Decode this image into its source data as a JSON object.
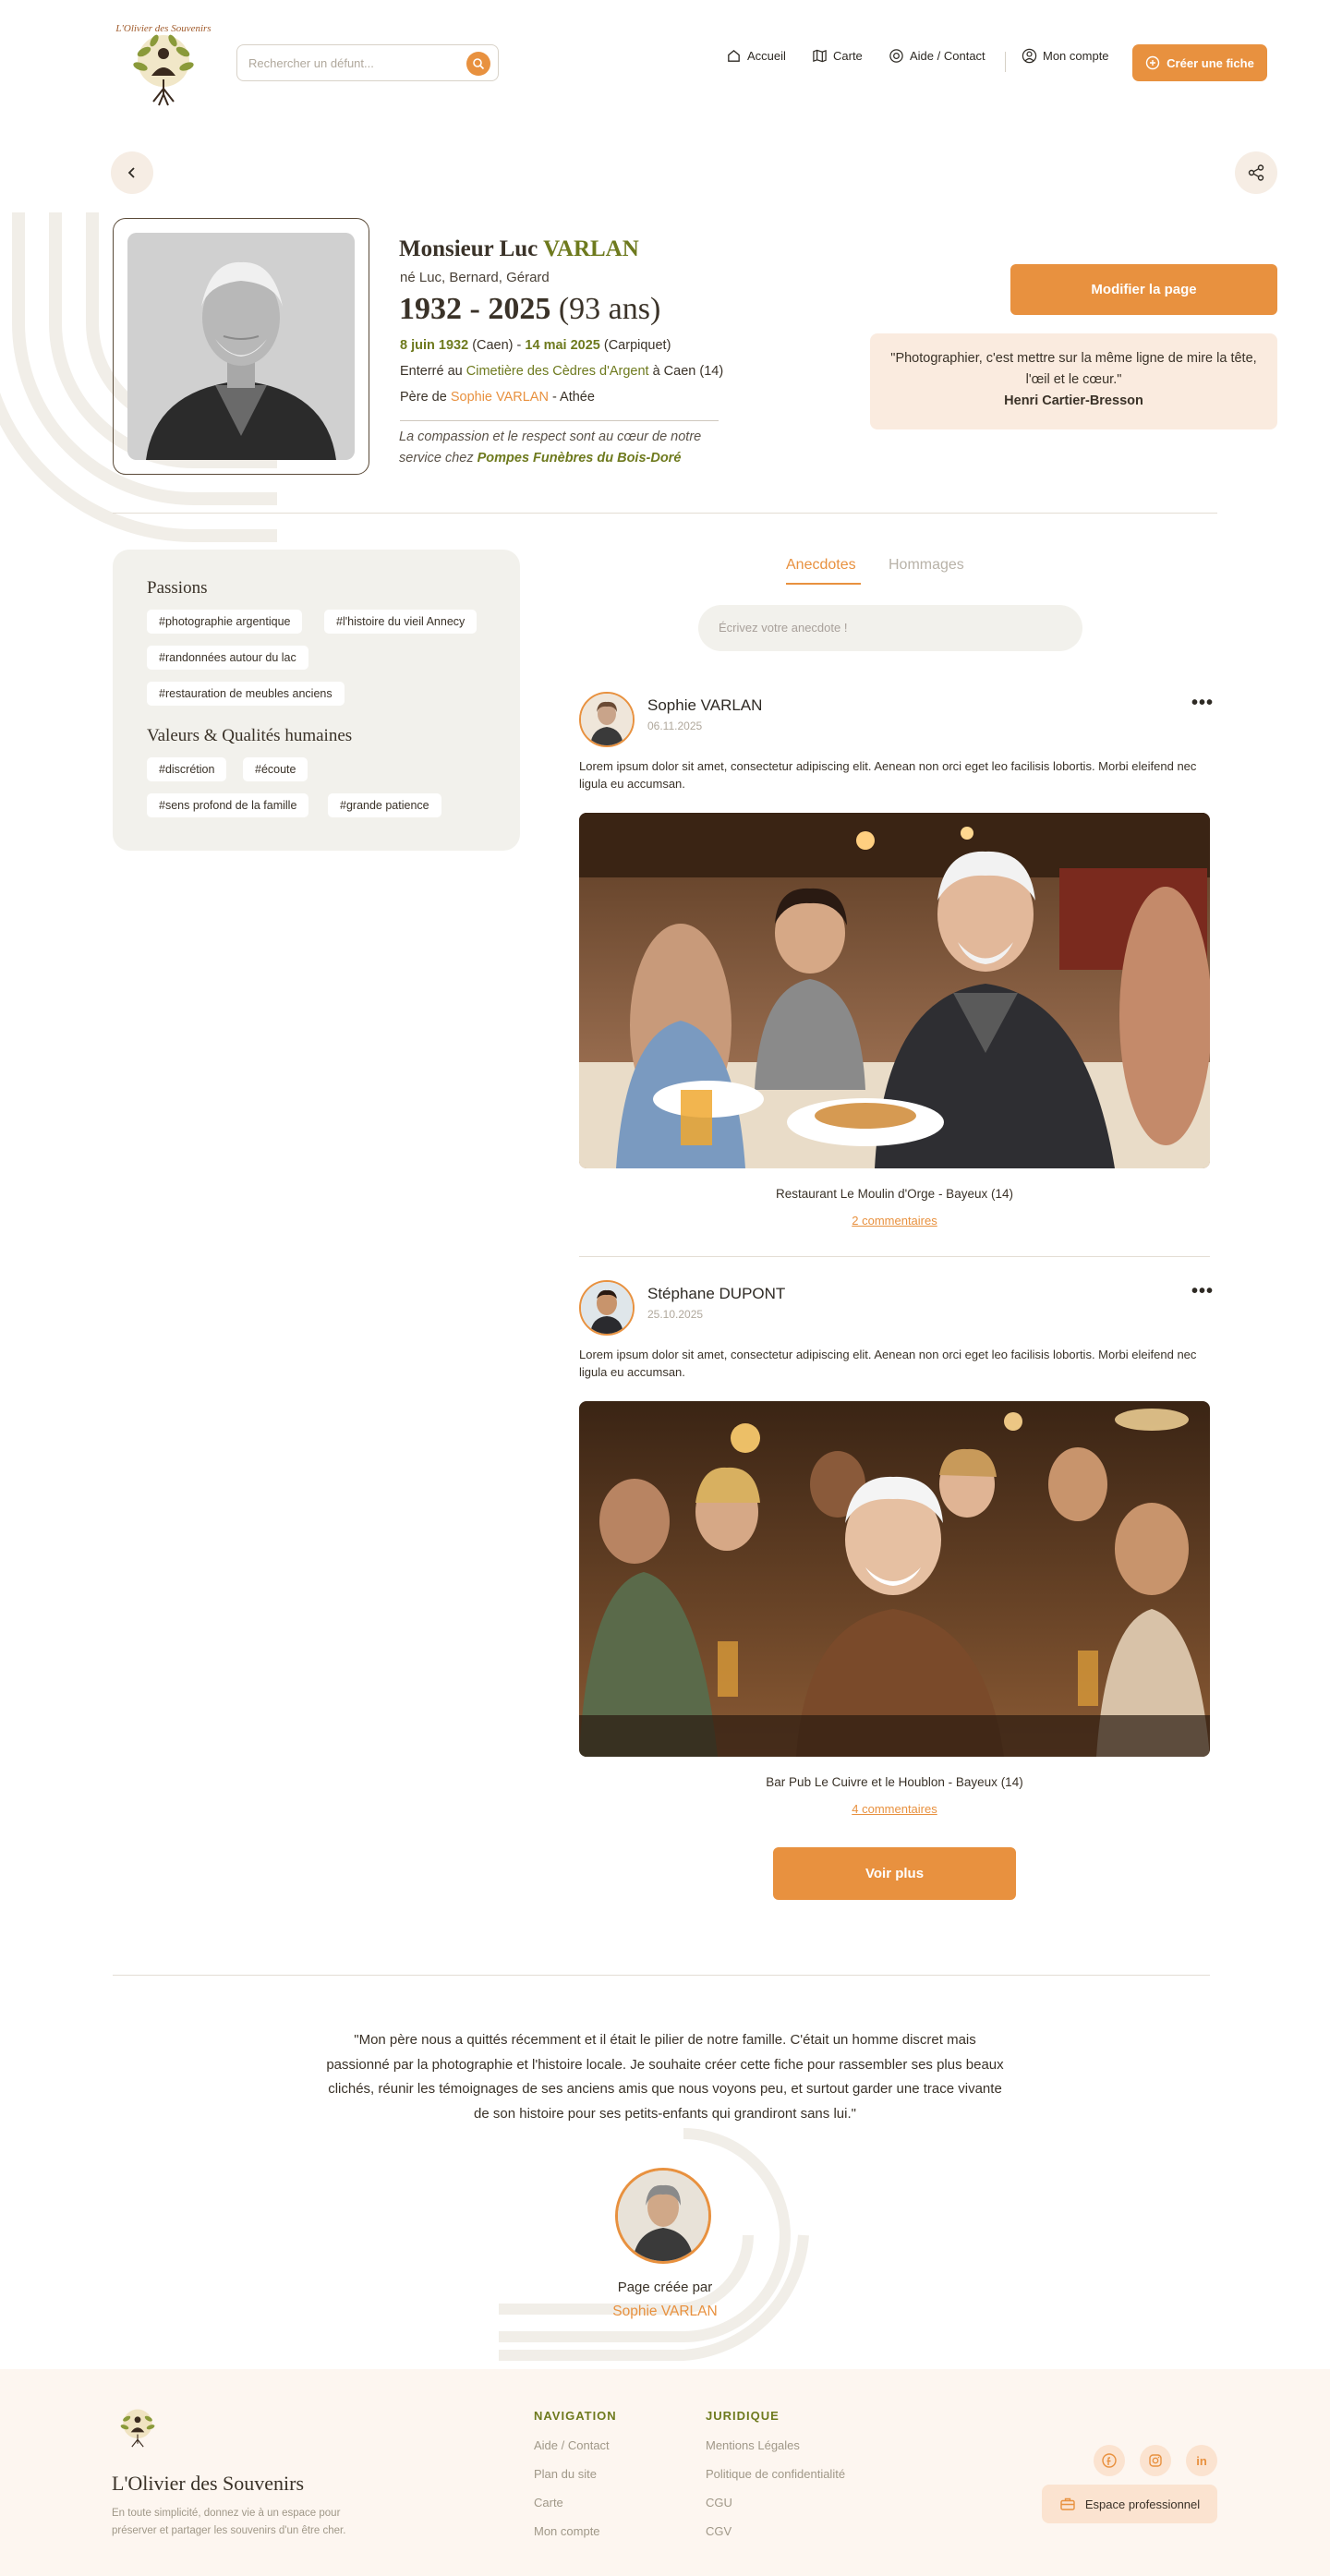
{
  "header": {
    "logo_text": "L'Olivier des Souvenirs",
    "search_placeholder": "Rechercher un défunt...",
    "nav": {
      "home": "Accueil",
      "map": "Carte",
      "help": "Aide / Contact",
      "account": "Mon compte"
    },
    "create_label": "Créer une fiche"
  },
  "profile": {
    "title_first": "Monsieur Luc",
    "title_last": "VARLAN",
    "born_names": "né Luc, Bernard,  Gérard",
    "years": "1932 - 2025",
    "age": "(93 ans)",
    "birth_date": "8 juin 1932",
    "birth_place": "(Caen) -",
    "death_date": "14 mai 2025",
    "death_place": "(Carpiquet)",
    "buried_prefix": "Enterré au",
    "cemetery": "Cimetière des Cèdres d'Argent",
    "buried_suffix": "à Caen (14)",
    "father_prefix": "Père de",
    "children_link": "Sophie VARLAN",
    "children_rest": "- Athée",
    "service_text": "La compassion et le respect sont au cœur de notre service chez",
    "service_name": "Pompes Funèbres du Bois-Doré"
  },
  "actions": {
    "modify_label": "Modifier la page"
  },
  "quote": {
    "line1": "\"Photographier, c'est mettre sur la même ligne de mire la tête,",
    "line2": "l'œil et le cœur.\"",
    "author": "Henri Cartier-Bresson"
  },
  "passions": {
    "title": "Passions",
    "tags": [
      "#photographie argentique",
      "#l'histoire du vieil Annecy",
      "#randonnées autour du lac",
      "#restauration de meubles anciens"
    ]
  },
  "values": {
    "title": "Valeurs & Qualités humaines",
    "tags": [
      "#discrétion",
      "#écoute",
      "#sens profond de la famille",
      "#grande patience"
    ]
  },
  "tabs": {
    "anecdotes": "Anecdotes",
    "tributes": "Hommages"
  },
  "anecdote_placeholder": "Écrivez votre anecdote !",
  "posts": [
    {
      "author": "Sophie VARLAN",
      "date": "06.11.2025",
      "text": "Lorem ipsum dolor sit amet, consectetur adipiscing elit. Aenean non orci eget leo facilisis lobortis. Morbi eleifend nec ligula eu accumsan.",
      "caption": "Restaurant Le Moulin d'Orge - Bayeux (14)",
      "comments": "2 commentaires"
    },
    {
      "author": "Stéphane DUPONT",
      "date": "25.10.2025",
      "text": "Lorem ipsum dolor sit amet, consectetur adipiscing elit. Aenean non orci eget leo facilisis lobortis. Morbi eleifend nec ligula eu accumsan.",
      "caption": "Bar Pub Le Cuivre et le Houblon - Bayeux (14)",
      "comments": "4 commentaires"
    }
  ],
  "more_label": "Voir plus",
  "testimonial": "\"Mon père nous a quittés récemment et il était le pilier de notre famille. C'était un homme discret mais passionné par la photographie et l'histoire locale. Je souhaite créer cette fiche pour rassembler ses plus beaux clichés, réunir les témoignages de ses anciens amis que nous voyons peu, et surtout garder une trace vivante de son histoire pour ses petits-enfants qui grandiront sans lui.\"",
  "creator": {
    "label": "Page créée par",
    "name": "Sophie VARLAN"
  },
  "footer": {
    "brand": "L'Olivier des Souvenirs",
    "description": "En toute simplicité, donnez vie à un espace pour préserver et partager les souvenirs d'un être cher.",
    "nav_title": "NAVIGATION",
    "nav_links": [
      "Aide / Contact",
      "Plan du site",
      "Carte",
      "Mon compte"
    ],
    "legal_title": "JURIDIQUE",
    "legal_links": [
      "Mentions Légales",
      "Politique de confidentialité",
      "CGU",
      "CGV"
    ],
    "pro_label": "Espace professionnel"
  },
  "colors": {
    "accent": "#e8913f",
    "olive": "#6e7a1e",
    "panel": "#f2f1ec",
    "quote_bg": "#faebdf"
  }
}
